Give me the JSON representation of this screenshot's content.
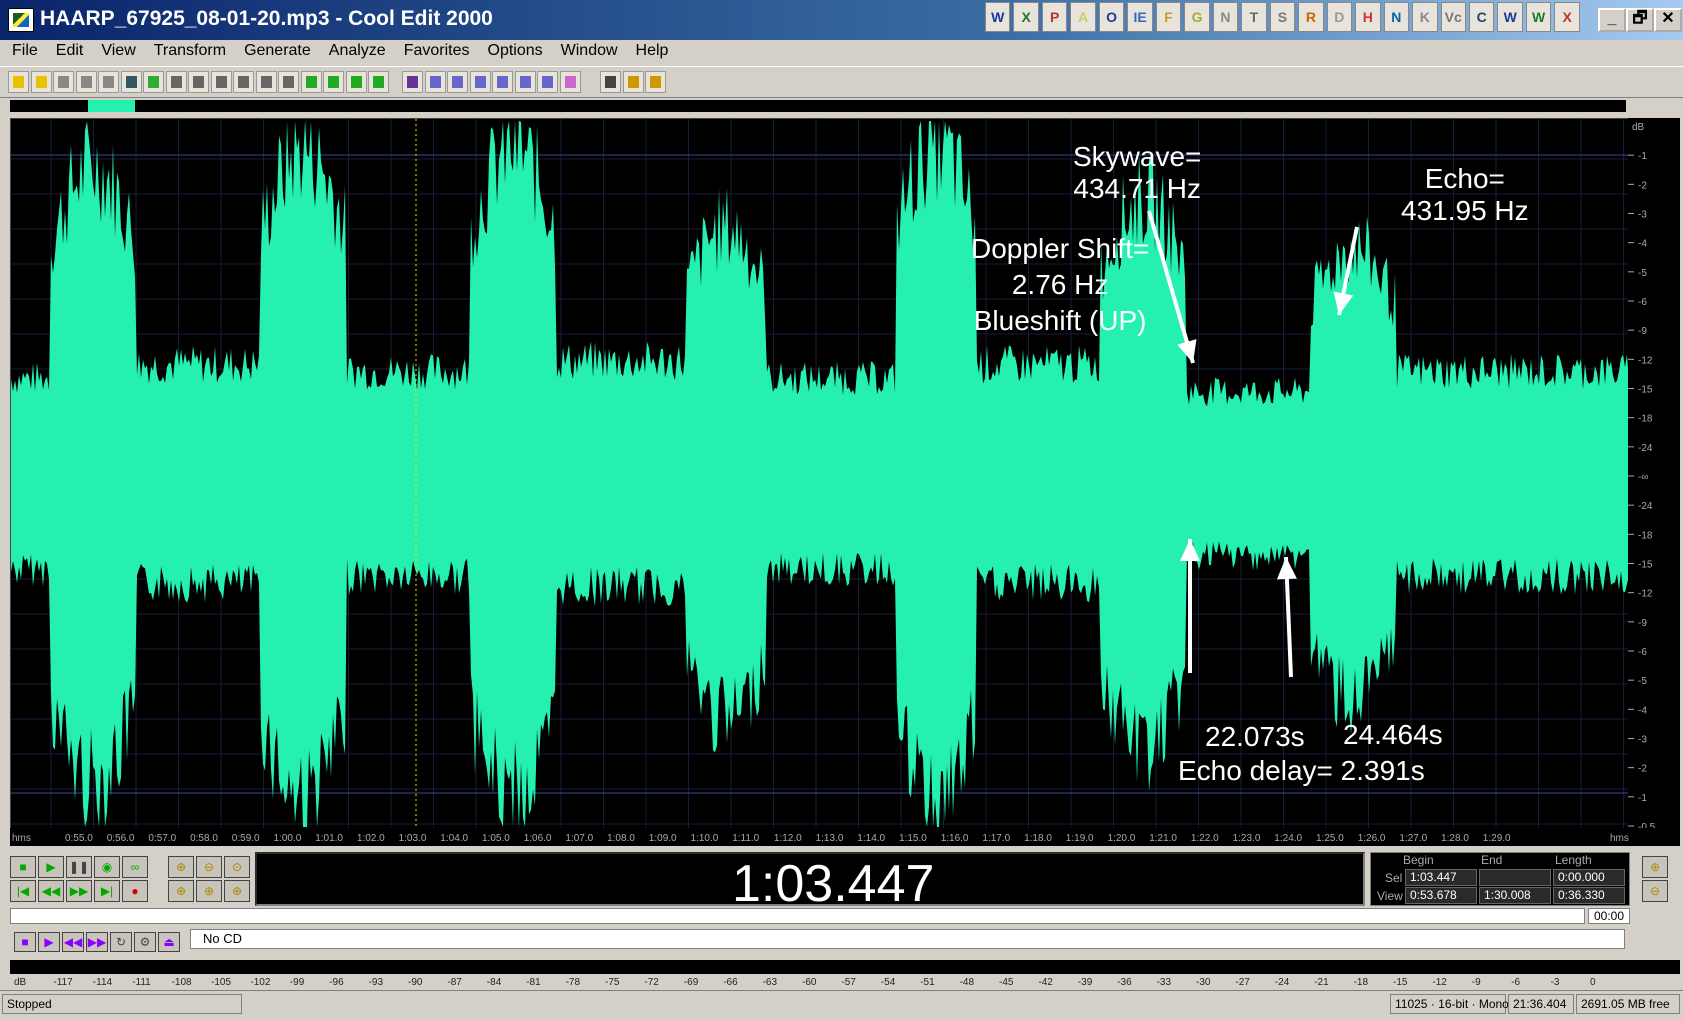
{
  "window": {
    "title": "HAARP_67925_08-01-20.mp3 - Cool Edit 2000",
    "minimize": "_",
    "maximize": "🗗",
    "close": "✕"
  },
  "tray_icons": [
    "W",
    "X",
    "P",
    "A",
    "O",
    "IE",
    "F",
    "G",
    "N",
    "T",
    "S",
    "R",
    "D",
    "H",
    "N",
    "K",
    "Vc",
    "C",
    "W",
    "W",
    "X"
  ],
  "menu": [
    "File",
    "Edit",
    "View",
    "Transform",
    "Generate",
    "Analyze",
    "Favorites",
    "Options",
    "Window",
    "Help"
  ],
  "waveform": {
    "color": "#25f0b0",
    "background": "#000000"
  },
  "annotations": {
    "skywave": [
      "Skywave=",
      "434.71 Hz"
    ],
    "echo": [
      "Echo=",
      "431.95 Hz"
    ],
    "doppler": [
      "Doppler Shift=",
      "2.76 Hz",
      "Blueshift (UP)"
    ],
    "time1": "22.073s",
    "time2": "24.464s",
    "echo_delay": "Echo delay= 2.391s"
  },
  "db_scale": [
    "dB",
    "-1",
    "-2",
    "-3",
    "-4",
    "-5",
    "-6",
    "-9",
    "-12",
    "-15",
    "-18",
    "-24",
    "-∞",
    "-24",
    "-18",
    "-15",
    "-12",
    "-9",
    "-6",
    "-5",
    "-4",
    "-3",
    "-2",
    "-1",
    "-0.5"
  ],
  "time_ruler": [
    "hms",
    "0:55.0",
    "0:56.0",
    "0:57.0",
    "0:58.0",
    "0:59.0",
    "1:00.0",
    "1:01.0",
    "1:02.0",
    "1:03.0",
    "1:04.0",
    "1:05.0",
    "1:06.0",
    "1:07.0",
    "1:08.0",
    "1:09.0",
    "1:10.0",
    "1:11.0",
    "1:12.0",
    "1:13.0",
    "1:14.0",
    "1:15.0",
    "1:16.0",
    "1:17.0",
    "1:18.0",
    "1:19.0",
    "1:20.0",
    "1:21.0",
    "1:22.0",
    "1:23.0",
    "1:24.0",
    "1:25.0",
    "1:26.0",
    "1:27.0",
    "1:28.0",
    "1:29.0",
    "hms"
  ],
  "time_display": "1:03.447",
  "selection": {
    "begin_label": "Begin",
    "end_label": "End",
    "length_label": "Length",
    "sel_label": "Sel",
    "view_label": "View",
    "sel_begin": "1:03.447",
    "sel_end": "",
    "sel_length": "0:00.000",
    "view_begin": "0:53.678",
    "view_end": "1:30.008",
    "view_length": "0:36.330"
  },
  "progress_time": "00:00",
  "cd_status": "No CD",
  "meter_scale": [
    "dB",
    "-117",
    "-114",
    "-111",
    "-108",
    "-105",
    "-102",
    "-99",
    "-96",
    "-93",
    "-90",
    "-87",
    "-84",
    "-81",
    "-78",
    "-75",
    "-72",
    "-69",
    "-66",
    "-63",
    "-60",
    "-57",
    "-54",
    "-51",
    "-48",
    "-45",
    "-42",
    "-39",
    "-36",
    "-33",
    "-30",
    "-27",
    "-24",
    "-21",
    "-18",
    "-15",
    "-12",
    "-9",
    "-6",
    "-3",
    "0"
  ],
  "status": {
    "state": "Stopped",
    "format": "11025 · 16-bit · Mono",
    "duration": "21:36.404",
    "free": "2691.05 MB free"
  }
}
